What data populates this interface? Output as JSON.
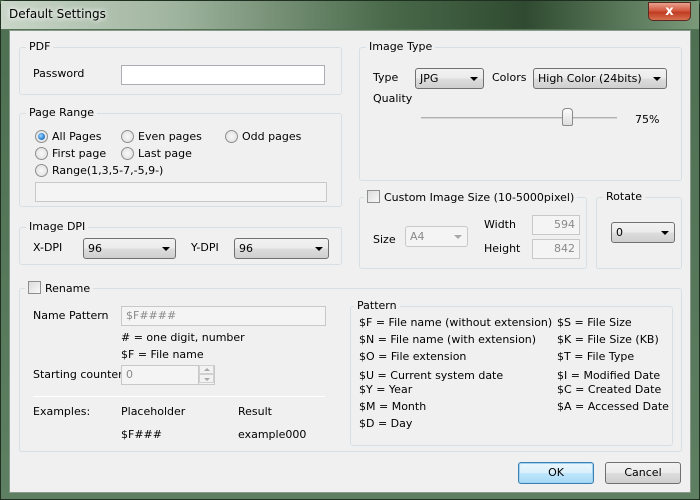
{
  "window": {
    "title": "Default Settings",
    "close_label": "x"
  },
  "pdf": {
    "legend": "PDF",
    "password_label": "Password",
    "password_value": ""
  },
  "page_range": {
    "legend": "Page Range",
    "options": [
      {
        "label": "All Pages",
        "checked": true
      },
      {
        "label": "Even pages",
        "checked": false
      },
      {
        "label": "Odd pages",
        "checked": false
      },
      {
        "label": "First page",
        "checked": false
      },
      {
        "label": "Last page",
        "checked": false
      },
      {
        "label": "Range(1,3,5-7,-5,9-)",
        "checked": false
      }
    ],
    "range_value": ""
  },
  "image_dpi": {
    "legend": "Image DPI",
    "x_label": "X-DPI",
    "x_value": "96",
    "y_label": "Y-DPI",
    "y_value": "96"
  },
  "image_type": {
    "legend": "Image Type",
    "type_label": "Type",
    "type_value": "JPG",
    "colors_label": "Colors",
    "colors_value": "High Color (24bits)",
    "quality_label": "Quality",
    "quality_percent": 75,
    "quality_text": "75%"
  },
  "custom_size": {
    "checkbox_label": "Custom Image Size (10-5000pixel)",
    "checked": false,
    "size_label": "Size",
    "size_value": "A4",
    "width_label": "Width",
    "width_value": "594",
    "height_label": "Height",
    "height_value": "842"
  },
  "rotate": {
    "legend": "Rotate",
    "value": "0"
  },
  "rename": {
    "checkbox_label": "Rename",
    "checked": false,
    "name_pattern_label": "Name Pattern",
    "name_pattern_value": "$F####",
    "hint_1": "# = one digit, number",
    "hint_2": "$F = File name",
    "starting_counter_label": "Starting counter",
    "starting_counter_value": "0",
    "examples_label": "Examples:",
    "placeholder_header": "Placeholder",
    "result_header": "Result",
    "example_placeholder": "$F###",
    "example_result": "example000"
  },
  "pattern": {
    "legend": "Pattern",
    "left": [
      "$F = File name (without extension)",
      "$N = File name (with extension)",
      "$O = File extension",
      "$U = Current system date",
      "$Y = Year",
      "$M = Month",
      "$D = Day"
    ],
    "right": [
      "$S = File Size",
      "$K = File Size (KB)",
      "$T = File Type",
      "$I = Modified Date",
      "$C = Created Date",
      "$A = Accessed Date"
    ]
  },
  "buttons": {
    "ok": "OK",
    "cancel": "Cancel"
  }
}
